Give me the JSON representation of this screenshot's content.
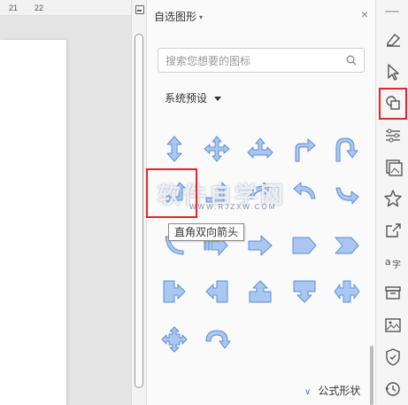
{
  "ruler": {
    "mark_21": "21",
    "mark_22": "22"
  },
  "panel": {
    "title": "自选图形",
    "close_label": "×",
    "search_placeholder": "搜索您想要的图标",
    "preset_label": "系统预设",
    "tooltip": "直角双向箭头",
    "formula_label": "公式形状"
  },
  "watermark": {
    "main": "软件自学网",
    "sub": "WWW.RJZXW.COM"
  },
  "shapes": [
    {
      "name": "up-down-arrow-icon"
    },
    {
      "name": "quad-arrow-icon"
    },
    {
      "name": "left-right-up-arrow-icon"
    },
    {
      "name": "bent-arrow-icon"
    },
    {
      "name": "u-turn-arrow-icon"
    },
    {
      "name": "left-up-arrow-icon"
    },
    {
      "name": "bent-up-arrow-icon"
    },
    {
      "name": "curved-right-arrow-icon"
    },
    {
      "name": "curved-left-arrow-icon"
    },
    {
      "name": "curved-up-arrow-icon"
    },
    {
      "name": "curved-down-arrow-icon"
    },
    {
      "name": "striped-right-arrow-icon"
    },
    {
      "name": "right-arrow-icon"
    },
    {
      "name": "pentagon-arrow-icon"
    },
    {
      "name": "chevron-arrow-icon"
    },
    {
      "name": "right-arrow-callout-icon"
    },
    {
      "name": "left-arrow-callout-icon"
    },
    {
      "name": "up-arrow-callout-icon"
    },
    {
      "name": "down-arrow-callout-icon"
    },
    {
      "name": "left-right-arrow-callout-icon"
    },
    {
      "name": "quad-arrow-callout-icon"
    },
    {
      "name": "circular-arrow-icon"
    }
  ],
  "sidebar": {
    "items": [
      {
        "name": "eraser-icon"
      },
      {
        "name": "select-pointer-icon"
      },
      {
        "name": "shapes-icon",
        "active": true
      },
      {
        "name": "adjust-settings-icon"
      },
      {
        "name": "image-gallery-icon"
      },
      {
        "name": "favorite-star-icon"
      },
      {
        "name": "share-export-icon"
      },
      {
        "name": "translate-icon"
      },
      {
        "name": "archive-box-icon"
      },
      {
        "name": "picture-icon"
      },
      {
        "name": "shield-check-icon"
      },
      {
        "name": "history-icon"
      }
    ]
  },
  "colors": {
    "shape_fill": "#a9c7f0",
    "shape_stroke": "#5b8fd9",
    "highlight": "#e3262b",
    "accent": "#4a7bd6"
  }
}
